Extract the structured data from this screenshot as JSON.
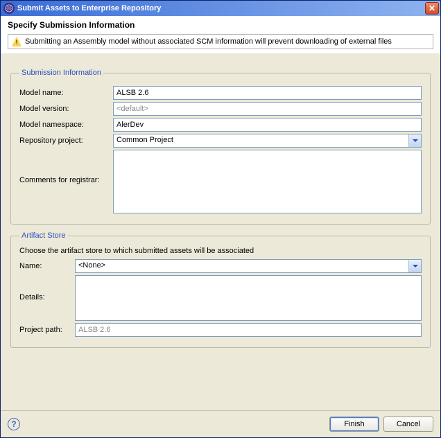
{
  "titlebar": {
    "title": "Submit Assets to Enterprise Repository"
  },
  "header": {
    "heading": "Specify Submission Information",
    "warning": "Submitting an Assembly model without associated SCM information will prevent downloading of external files"
  },
  "submission": {
    "legend": "Submission Information",
    "labels": {
      "model_name": "Model name:",
      "model_version": "Model version:",
      "model_namespace": "Model namespace:",
      "repository_project": "Repository project:",
      "comments": "Comments for registrar:"
    },
    "values": {
      "model_name": "ALSB 2.6",
      "model_version": "<default>",
      "model_namespace": "AlerDev",
      "repository_project": "Common Project",
      "comments": ""
    }
  },
  "artifact": {
    "legend": "Artifact Store",
    "instruction": "Choose the artifact store to which submitted assets will be associated",
    "labels": {
      "name": "Name:",
      "details": "Details:",
      "project_path": "Project path:"
    },
    "values": {
      "name": "<None>",
      "details": "",
      "project_path": "ALSB 2.6"
    }
  },
  "buttons": {
    "finish": "Finish",
    "cancel": "Cancel"
  }
}
